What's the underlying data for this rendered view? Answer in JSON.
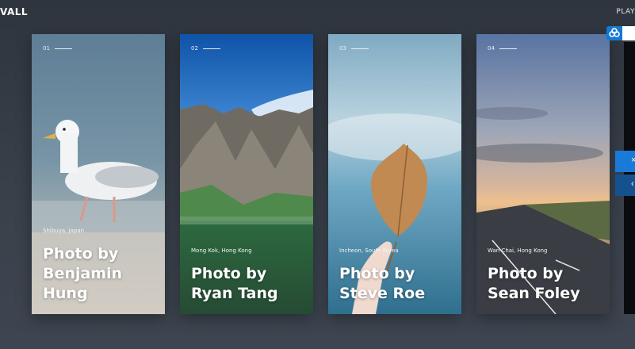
{
  "header": {
    "brand": "VALL",
    "play_label": "PLAY"
  },
  "cards": [
    {
      "num": "01",
      "location": "Shibuya, Japan",
      "title": "Photo by Benjamin Hung"
    },
    {
      "num": "02",
      "location": "Mong Kok, Hong Kong",
      "title": "Photo by Ryan Tang"
    },
    {
      "num": "03",
      "location": "Incheon, South Korea",
      "title": "Photo by Steve Roe"
    },
    {
      "num": "04",
      "location": "Wan Chai, Hong Kong",
      "title": "Photo by Sean Foley"
    }
  ],
  "side": {
    "top_icon": "infinity-icon",
    "next_icon": "close-icon",
    "prev_icon": "chevron-left-icon"
  }
}
